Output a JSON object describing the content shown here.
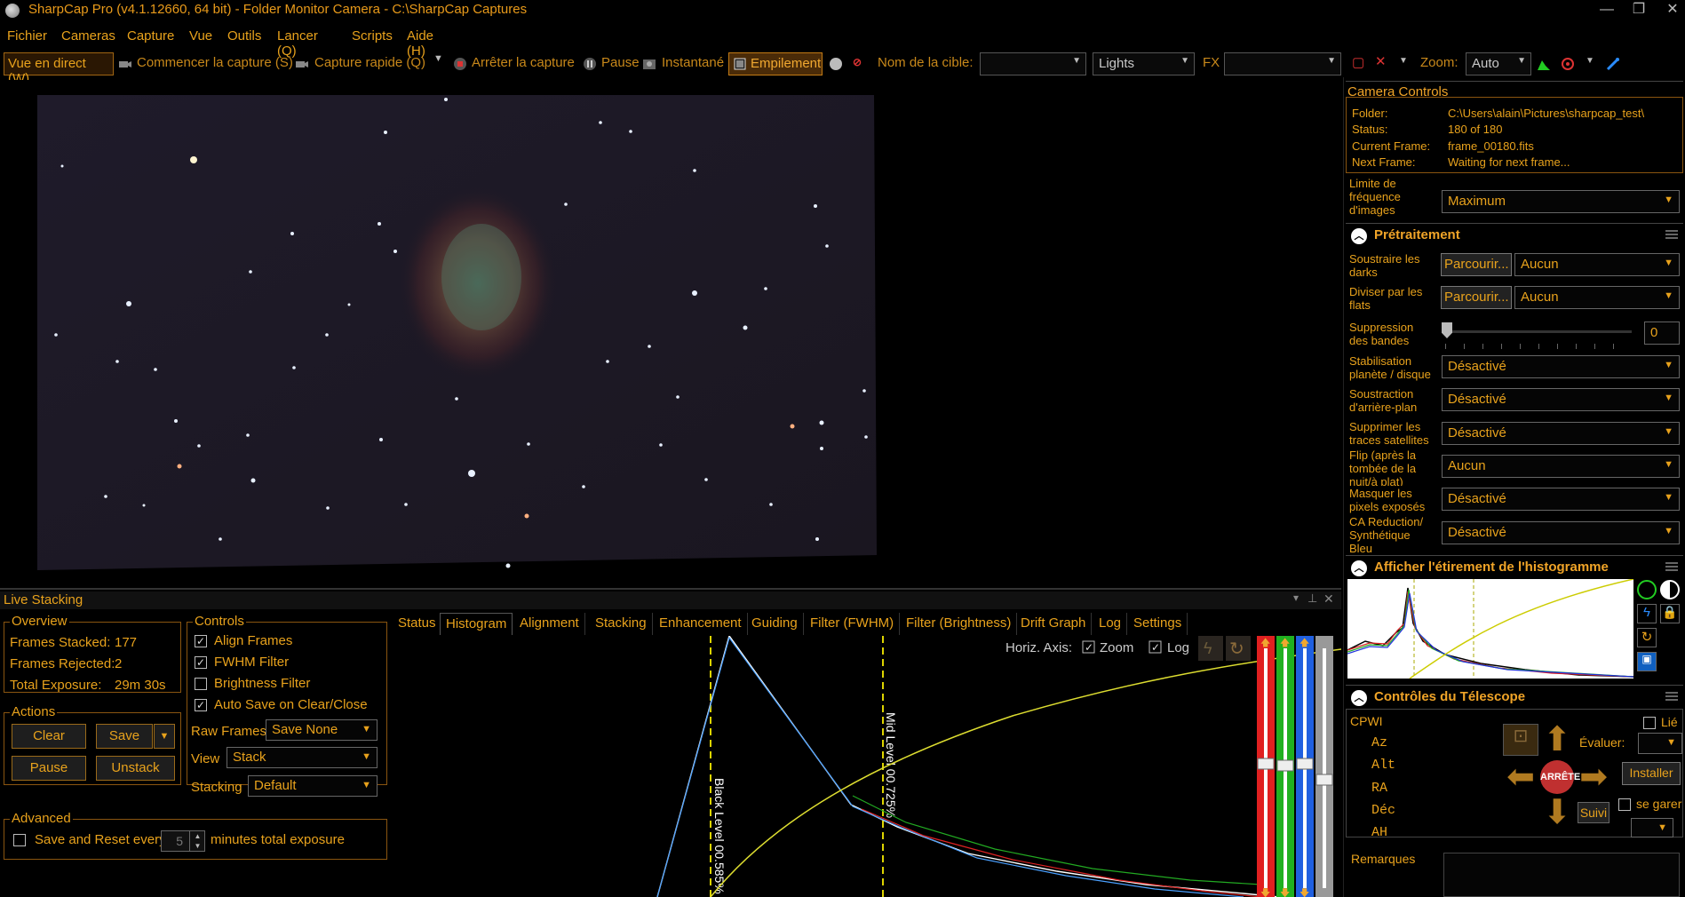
{
  "window": {
    "title": "SharpCap Pro (v4.1.12660, 64 bit) - Folder Monitor Camera - C:\\SharpCap Captures"
  },
  "menu": [
    "Fichier",
    "Cameras",
    "Capture",
    "Vue",
    "Outils",
    "Lancer (Q)",
    "Scripts",
    "Aide (H)"
  ],
  "toolbar": {
    "live_view": "Vue en direct (W)",
    "start_capture": "Commencer la capture (S)",
    "quick_capture": "Capture rapide (Q)",
    "stop_capture": "Arrêter la capture",
    "pause": "Pause",
    "snapshot": "Instantané",
    "stacking": "Empilement",
    "target_label": "Nom de la cible:",
    "target_value": "",
    "frame_type": "Lights",
    "fx_label": "FX",
    "fx_value": "",
    "zoom_label": "Zoom:",
    "zoom_value": "Auto"
  },
  "camera_controls": {
    "title": "Camera Controls",
    "folder_label": "Folder:",
    "folder_value": "C:\\Users\\alain\\Pictures\\sharpcap_test\\",
    "status_label": "Status:",
    "status_value": "180 of 180",
    "current_frame_label": "Current Frame:",
    "current_frame_value": "frame_00180.fits",
    "next_frame_label": "Next Frame:",
    "next_frame_value": "Waiting for next frame...",
    "frame_rate_label": "Limite de fréquence d'images",
    "frame_rate_value": "Maximum"
  },
  "pretraitement": {
    "title": "Prétraitement",
    "darks_label": "Soustraire les darks",
    "darks_browse": "Parcourir...",
    "darks_value": "Aucun",
    "flats_label": "Diviser par les flats",
    "flats_browse": "Parcourir...",
    "flats_value": "Aucun",
    "banding_label": "Suppression des bandes",
    "banding_value": "0",
    "stab_label": "Stabilisation planète / disque",
    "stab_value": "Désactivé",
    "bg_label": "Soustraction d'arrière-plan",
    "bg_value": "Désactivé",
    "sat_label": "Supprimer les traces satellites",
    "sat_value": "Désactivé",
    "flip_label": "Flip (après la tombée de la nuit/à plat)",
    "flip_value": "Aucun",
    "mask_label": "Masquer les pixels exposés",
    "mask_value": "Désactivé",
    "ca_label": "CA Reduction/ Synthétique Bleu",
    "ca_value": "Désactivé"
  },
  "histogram_stretch": {
    "title": "Afficher l'étirement de l'histogramme"
  },
  "telescope": {
    "title": "Contrôles du Télescope",
    "mount": "CPWI",
    "linked": "Lié",
    "az": "Az",
    "alt": "Alt",
    "ra": "RA",
    "dec": "Déc",
    "ah": "AH",
    "evaluate": "Évaluer:",
    "install": "Installer",
    "park": "se garer",
    "stop": "ARRÊTE",
    "track": "Suivi",
    "notes": "Remarques"
  },
  "live_stacking": {
    "title": "Live Stacking",
    "overview_title": "Overview",
    "frames_stacked_label": "Frames Stacked:",
    "frames_stacked": "177",
    "frames_rejected_label": "Frames Rejected:",
    "frames_rejected": "2",
    "total_exposure_label": "Total Exposure:",
    "total_exposure": "29m 30s",
    "actions_title": "Actions",
    "clear": "Clear",
    "save": "Save",
    "pause": "Pause",
    "unstack": "Unstack",
    "controls_title": "Controls",
    "align_frames": "Align Frames",
    "fwhm_filter": "FWHM Filter",
    "brightness_filter": "Brightness Filter",
    "auto_save": "Auto Save on Clear/Close",
    "raw_frames_label": "Raw Frames",
    "raw_frames_value": "Save None",
    "view_label": "View",
    "view_value": "Stack",
    "stacking_label": "Stacking",
    "stacking_value": "Default",
    "advanced_title": "Advanced",
    "save_reset_label": "Save and Reset every",
    "save_reset_value": "5",
    "save_reset_suffix": "minutes total exposure",
    "tabs": [
      "Status",
      "Histogram",
      "Alignment",
      "Stacking",
      "Enhancement",
      "Guiding",
      "Filter (FWHM)",
      "Filter (Brightness)",
      "Drift Graph",
      "Log",
      "Settings"
    ],
    "horiz_axis": "Horiz. Axis:",
    "zoom": "Zoom",
    "log": "Log",
    "black_level": "Black Level 00.585%",
    "mid_level": "Mid Level 00.725%"
  },
  "colors": {
    "accent": "#e8a21c",
    "background": "#000000",
    "red_channel": "#e02020",
    "green_channel": "#20b020",
    "blue_channel": "#2060e0"
  }
}
